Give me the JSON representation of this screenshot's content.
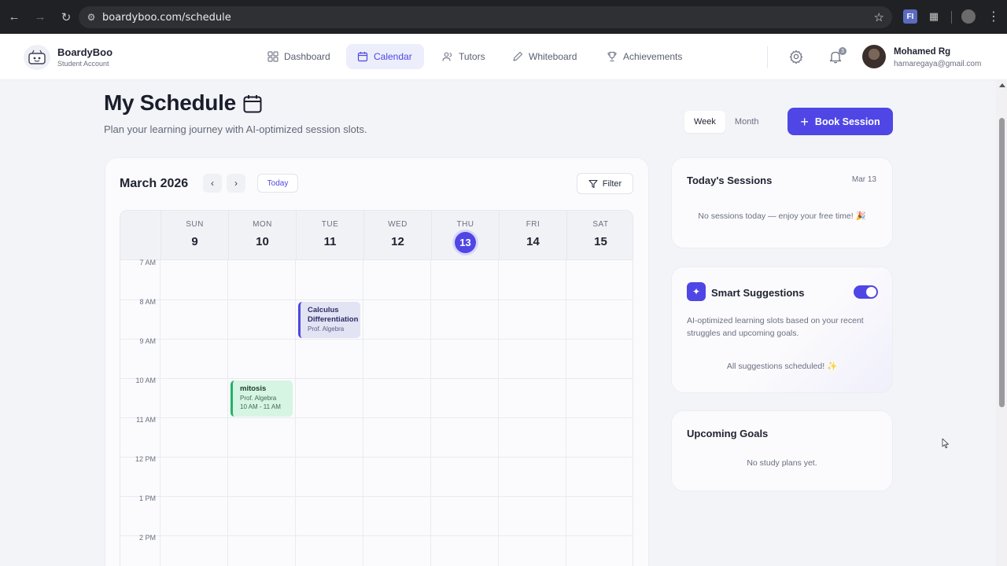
{
  "browser": {
    "url": "boardyboo.com/schedule",
    "notification_count": "3"
  },
  "app": {
    "brand": "BoardyBoo",
    "account_type": "Student Account",
    "nav": [
      {
        "label": "Dashboard",
        "icon": "grid-icon",
        "active": false
      },
      {
        "label": "Calendar",
        "icon": "calendar-icon",
        "active": true
      },
      {
        "label": "Tutors",
        "icon": "users-icon",
        "active": false
      },
      {
        "label": "Whiteboard",
        "icon": "pen-icon",
        "active": false
      },
      {
        "label": "Achievements",
        "icon": "trophy-icon",
        "active": false
      }
    ],
    "user": {
      "name": "Mohamed Rg",
      "email": "hamaregaya@gmail.com"
    }
  },
  "page": {
    "title": "My Schedule",
    "subtitle": "Plan your learning journey with AI-optimized session slots.",
    "view_options": [
      "Week",
      "Month"
    ],
    "active_view": "Week",
    "book_label": "Book Session"
  },
  "calendar": {
    "month": "March 2026",
    "today_label": "Today",
    "filter_label": "Filter",
    "days": [
      {
        "name": "SUN",
        "num": "9"
      },
      {
        "name": "MON",
        "num": "10"
      },
      {
        "name": "TUE",
        "num": "11"
      },
      {
        "name": "WED",
        "num": "12"
      },
      {
        "name": "THU",
        "num": "13",
        "today": true
      },
      {
        "name": "FRI",
        "num": "14"
      },
      {
        "name": "SAT",
        "num": "15"
      }
    ],
    "times": [
      "7 AM",
      "8 AM",
      "9 AM",
      "10 AM",
      "11 AM",
      "12 PM",
      "1 PM",
      "2 PM"
    ],
    "events": [
      {
        "title": "Calculus Differentiation",
        "tutor": "Prof. Algebra",
        "day": "TUE",
        "time": ""
      },
      {
        "title": "mitosis",
        "tutor": "Prof. Algebra",
        "day": "MON",
        "time": "10 AM - 11 AM"
      }
    ]
  },
  "sidebar": {
    "today": {
      "title": "Today's Sessions",
      "date": "Mar 13",
      "empty": "No sessions today — enjoy your free time! 🎉"
    },
    "smart": {
      "title": "Smart Suggestions",
      "enabled": true,
      "description": "AI-optimized learning slots based on your recent struggles and upcoming goals.",
      "status": "All suggestions scheduled! ✨"
    },
    "goals": {
      "title": "Upcoming Goals",
      "empty": "No study plans yet."
    }
  },
  "colors": {
    "accent": "#4f46e5",
    "event_calc_bg": "#e2e3f3",
    "event_mitosis_bg": "#d6f5e3",
    "event_mitosis_border": "#21b36a"
  }
}
